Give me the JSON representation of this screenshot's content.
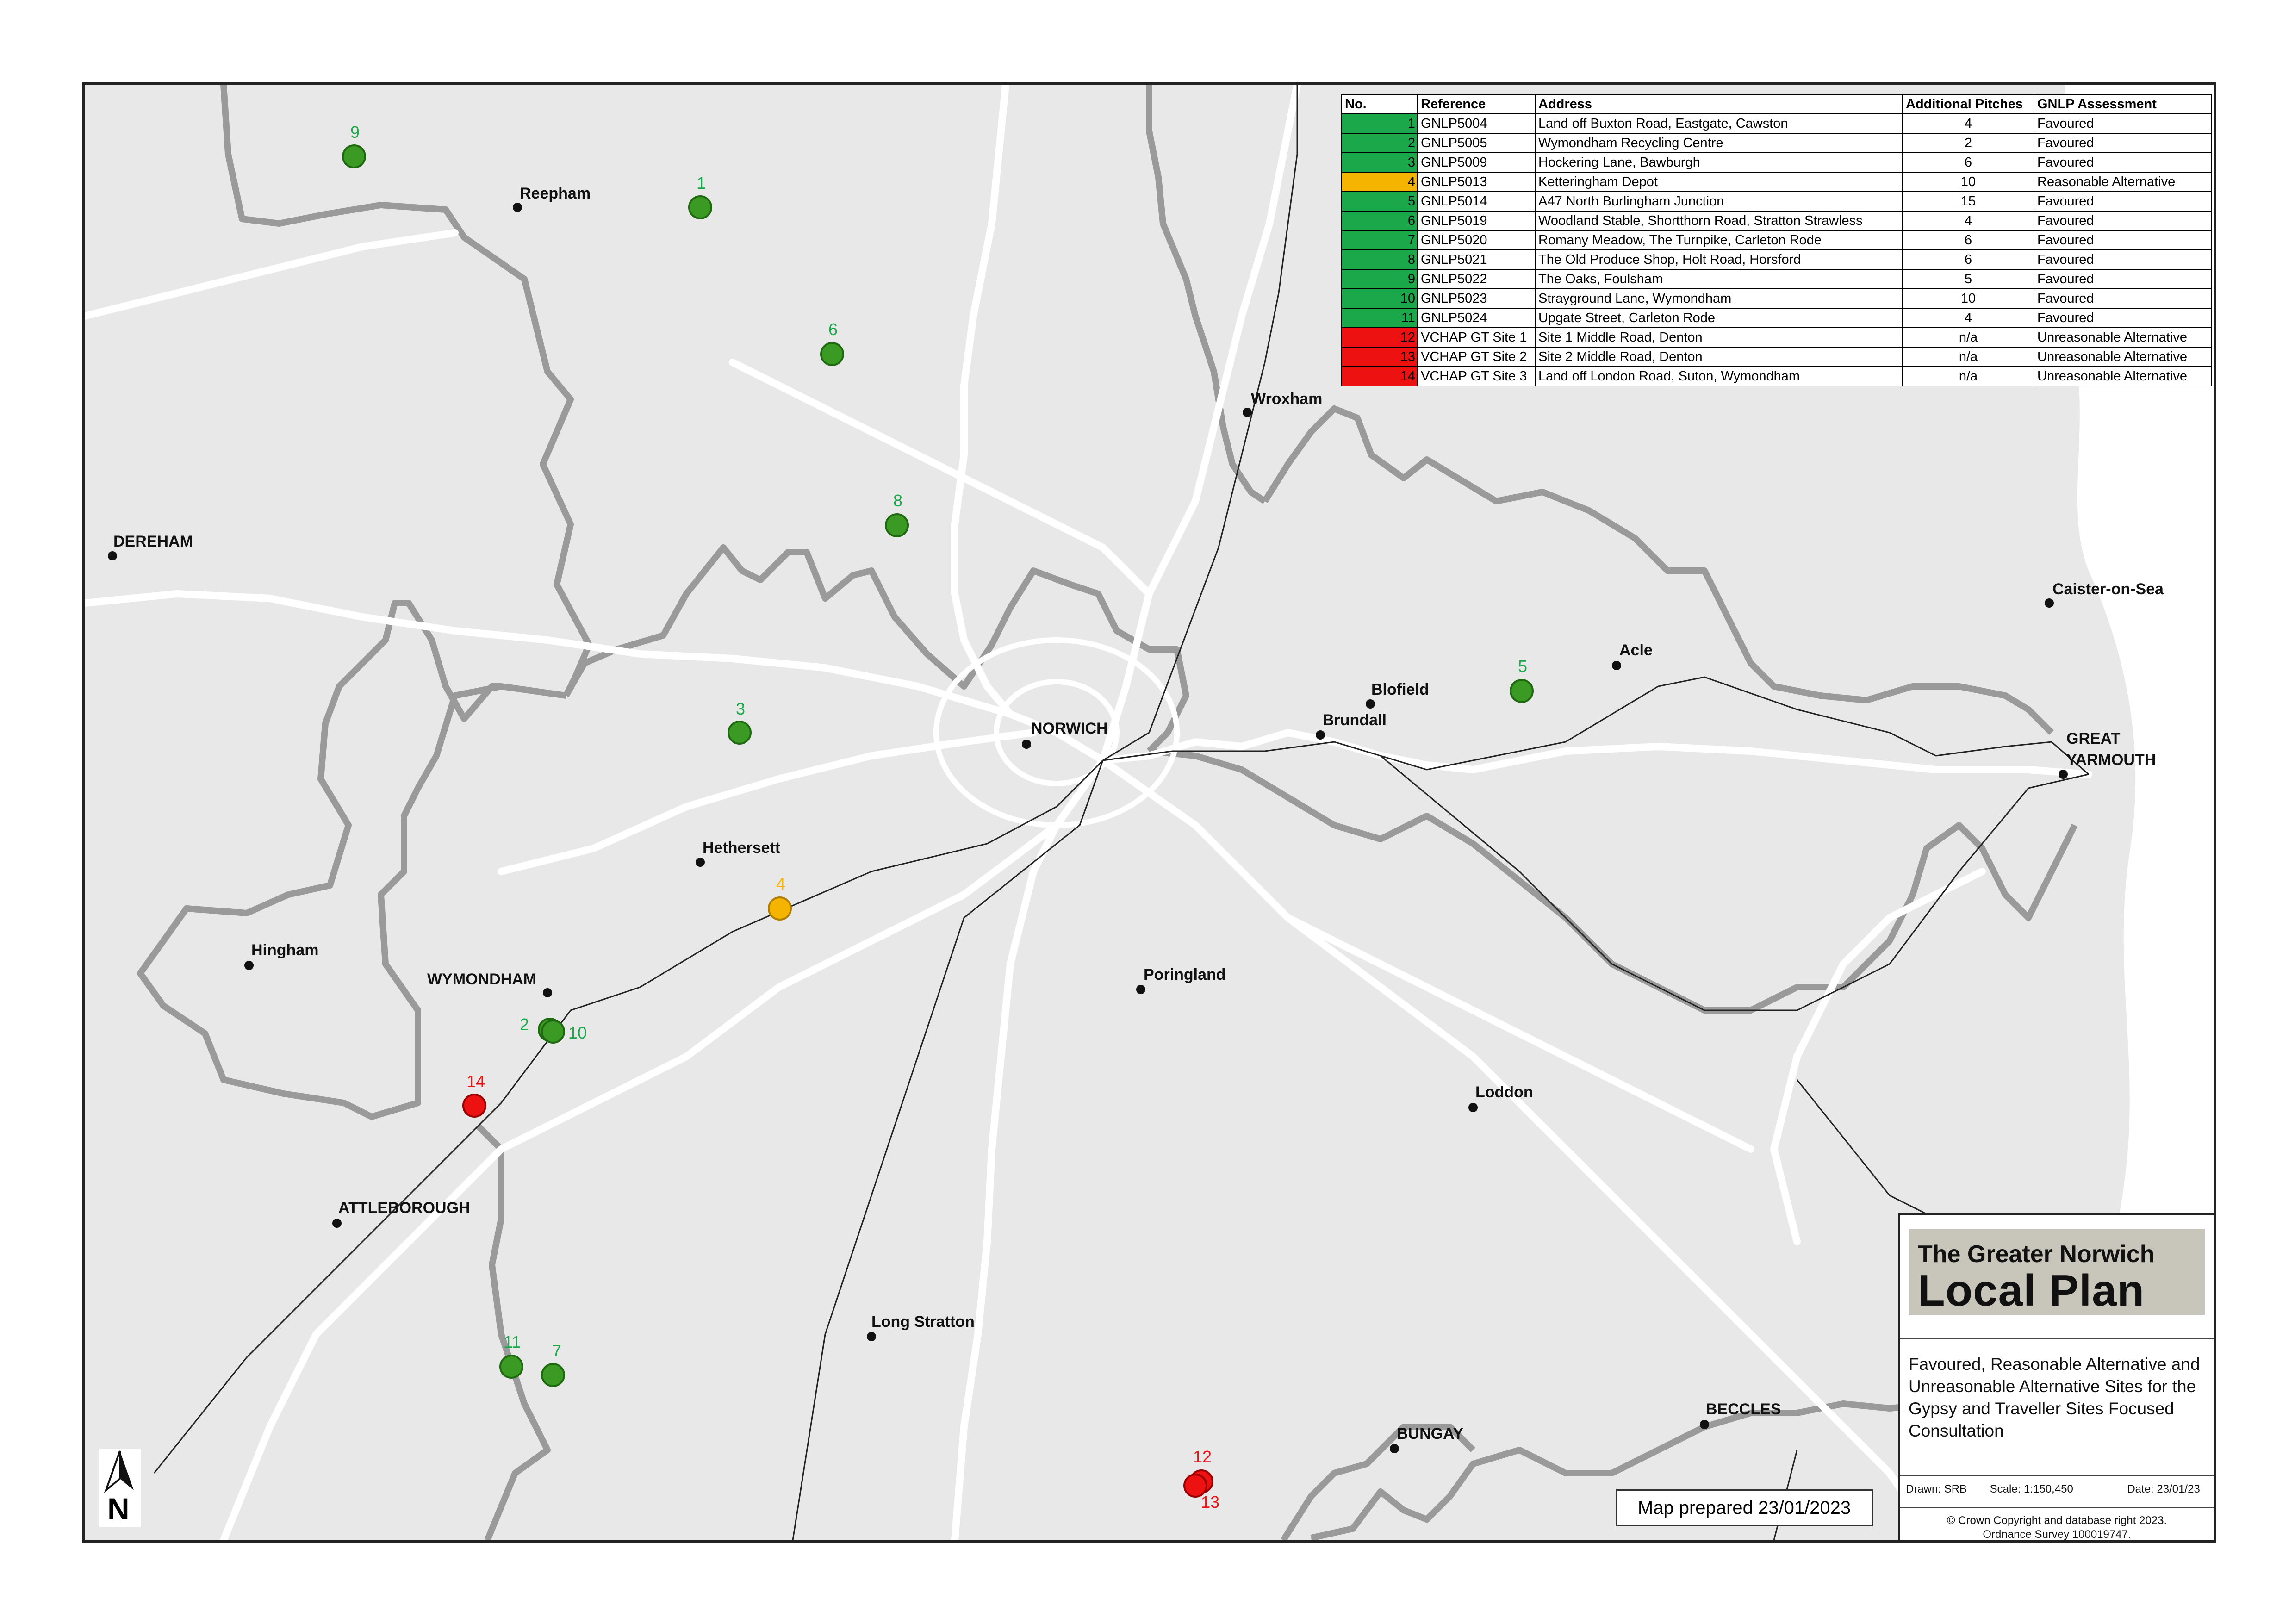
{
  "legend": {
    "headers": [
      "No.",
      "Reference",
      "Address",
      "Additional Pitches",
      "GNLP Assessment"
    ],
    "rows": [
      {
        "no": "1",
        "ref": "GNLP5004",
        "address": "Land off Buxton Road, Eastgate, Cawston",
        "pitches": "4",
        "assessment": "Favoured",
        "color": "#1aa84a"
      },
      {
        "no": "2",
        "ref": "GNLP5005",
        "address": "Wymondham Recycling Centre",
        "pitches": "2",
        "assessment": "Favoured",
        "color": "#1aa84a"
      },
      {
        "no": "3",
        "ref": "GNLP5009",
        "address": "Hockering Lane, Bawburgh",
        "pitches": "6",
        "assessment": "Favoured",
        "color": "#1aa84a"
      },
      {
        "no": "4",
        "ref": "GNLP5013",
        "address": "Ketteringham Depot",
        "pitches": "10",
        "assessment": "Reasonable Alternative",
        "color": "#f5b400"
      },
      {
        "no": "5",
        "ref": "GNLP5014",
        "address": "A47 North Burlingham Junction",
        "pitches": "15",
        "assessment": "Favoured",
        "color": "#1aa84a"
      },
      {
        "no": "6",
        "ref": "GNLP5019",
        "address": "Woodland Stable, Shortthorn Road, Stratton Strawless",
        "pitches": "4",
        "assessment": "Favoured",
        "color": "#1aa84a"
      },
      {
        "no": "7",
        "ref": "GNLP5020",
        "address": "Romany Meadow, The Turnpike, Carleton Rode",
        "pitches": "6",
        "assessment": "Favoured",
        "color": "#1aa84a"
      },
      {
        "no": "8",
        "ref": "GNLP5021",
        "address": "The Old Produce Shop, Holt Road, Horsford",
        "pitches": "6",
        "assessment": "Favoured",
        "color": "#1aa84a"
      },
      {
        "no": "9",
        "ref": "GNLP5022",
        "address": "The Oaks, Foulsham",
        "pitches": "5",
        "assessment": "Favoured",
        "color": "#1aa84a"
      },
      {
        "no": "10",
        "ref": "GNLP5023",
        "address": "Strayground Lane, Wymondham",
        "pitches": "10",
        "assessment": "Favoured",
        "color": "#1aa84a"
      },
      {
        "no": "11",
        "ref": "GNLP5024",
        "address": "Upgate Street, Carleton Rode",
        "pitches": "4",
        "assessment": "Favoured",
        "color": "#1aa84a"
      },
      {
        "no": "12",
        "ref": "VCHAP GT Site 1",
        "address": "Site 1 Middle Road, Denton",
        "pitches": "n/a",
        "assessment": "Unreasonable Alternative",
        "color": "#ee1111"
      },
      {
        "no": "13",
        "ref": "VCHAP GT Site 2",
        "address": "Site 2 Middle Road, Denton",
        "pitches": "n/a",
        "assessment": "Unreasonable Alternative",
        "color": "#ee1111"
      },
      {
        "no": "14",
        "ref": "VCHAP GT Site 3",
        "address": "Land off London Road, Suton, Wymondham",
        "pitches": "n/a",
        "assessment": "Unreasonable Alternative",
        "color": "#ee1111"
      }
    ]
  },
  "towns": {
    "reepham": "Reepham",
    "dereham": "DEREHAM",
    "wroxham": "Wroxham",
    "caister": "Caister-on-Sea",
    "acle": "Acle",
    "blofield": "Blofield",
    "brundall": "Brundall",
    "norwich": "NORWICH",
    "great_yarmouth_1": "GREAT",
    "great_yarmouth_2": "YARMOUTH",
    "hethersett": "Hethersett",
    "hingham": "Hingham",
    "wymondham": "WYMONDHAM",
    "poringland": "Poringland",
    "loddon": "Loddon",
    "attleborough": "ATTLEBOROUGH",
    "long_stratton": "Long Stratton",
    "bungay": "BUNGAY",
    "beccles": "BECCLES"
  },
  "site_labels": [
    "1",
    "2",
    "3",
    "4",
    "5",
    "6",
    "7",
    "8",
    "9",
    "10",
    "11",
    "12",
    "13",
    "14"
  ],
  "site_colors": {
    "favoured": "#1aa84a",
    "reasonable": "#f5b400",
    "unreasonable": "#ee1111"
  },
  "title_block": {
    "logo_line1": "The Greater Norwich",
    "logo_line2": "Local Plan",
    "description": "Favoured, Reasonable Alternative and Unreasonable Alternative Sites for the Gypsy and Traveller Sites Focused Consultation",
    "drawn": "Drawn:  SRB",
    "scale": "Scale:  1:150,450",
    "date": "Date: 23/01/23",
    "copyright_1": "© Crown Copyright and database right 2023.",
    "copyright_2": "Ordnance Survey 100019747."
  },
  "map_prepared": "Map prepared 23/01/2023",
  "north_label": "N"
}
